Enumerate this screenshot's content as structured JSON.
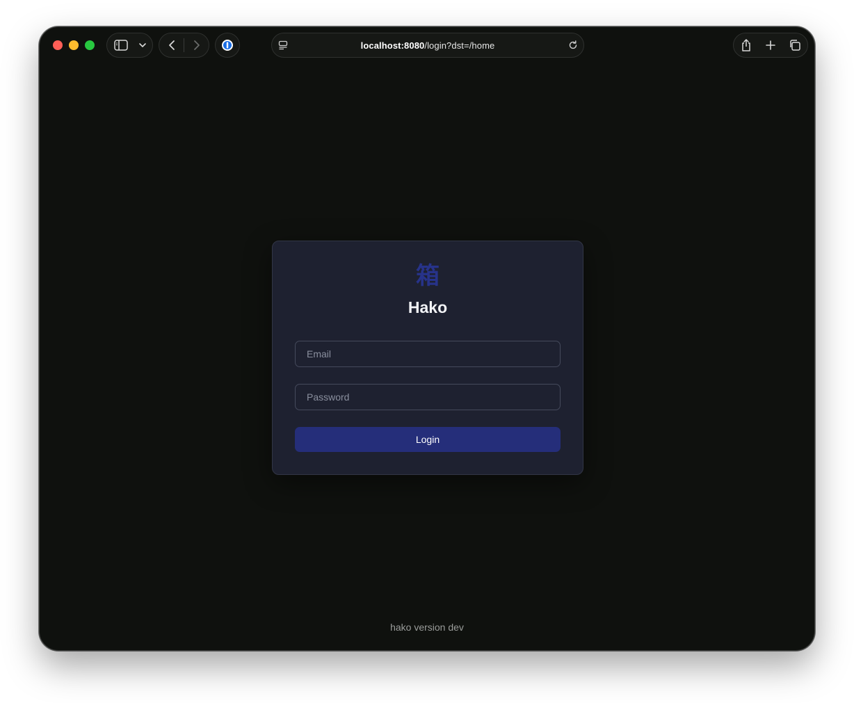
{
  "browser": {
    "url_host": "localhost:8080",
    "url_path": "/login?dst=/home",
    "icons": {
      "sidebar": "sidebar-icon",
      "chevron": "chevron-down-icon",
      "back": "back-icon",
      "forward": "forward-icon",
      "extension": "password-manager-icon",
      "page_menu": "page-menu-icon",
      "reload": "reload-icon",
      "share": "share-icon",
      "new_tab": "plus-icon",
      "tabs": "tabs-overview-icon"
    }
  },
  "login": {
    "logo_glyph": "箱",
    "title": "Hako",
    "email_placeholder": "Email",
    "password_placeholder": "Password",
    "submit_label": "Login"
  },
  "footer": {
    "version_text": "hako version dev"
  },
  "colors": {
    "background": "#0f110e",
    "card": "#1e2130",
    "accent": "#252e7a",
    "logo": "#27338a"
  }
}
